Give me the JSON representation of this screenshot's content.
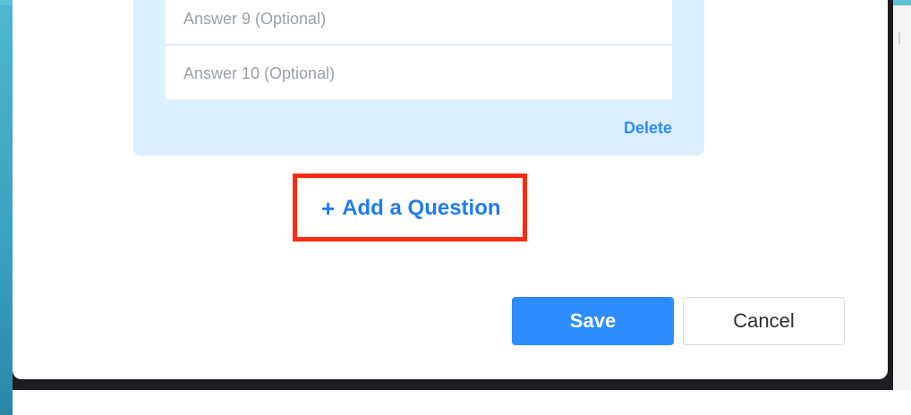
{
  "question_card": {
    "answers": [
      {
        "placeholder": "Answer 9 (Optional)"
      },
      {
        "placeholder": "Answer 10 (Optional)"
      }
    ],
    "delete_label": "Delete"
  },
  "add_question": {
    "plus": "+",
    "label": "Add a Question"
  },
  "buttons": {
    "save": "Save",
    "cancel": "Cancel"
  },
  "colors": {
    "accent": "#2d8cff",
    "card_bg": "#dcefff",
    "highlight": "#ff2a12"
  }
}
